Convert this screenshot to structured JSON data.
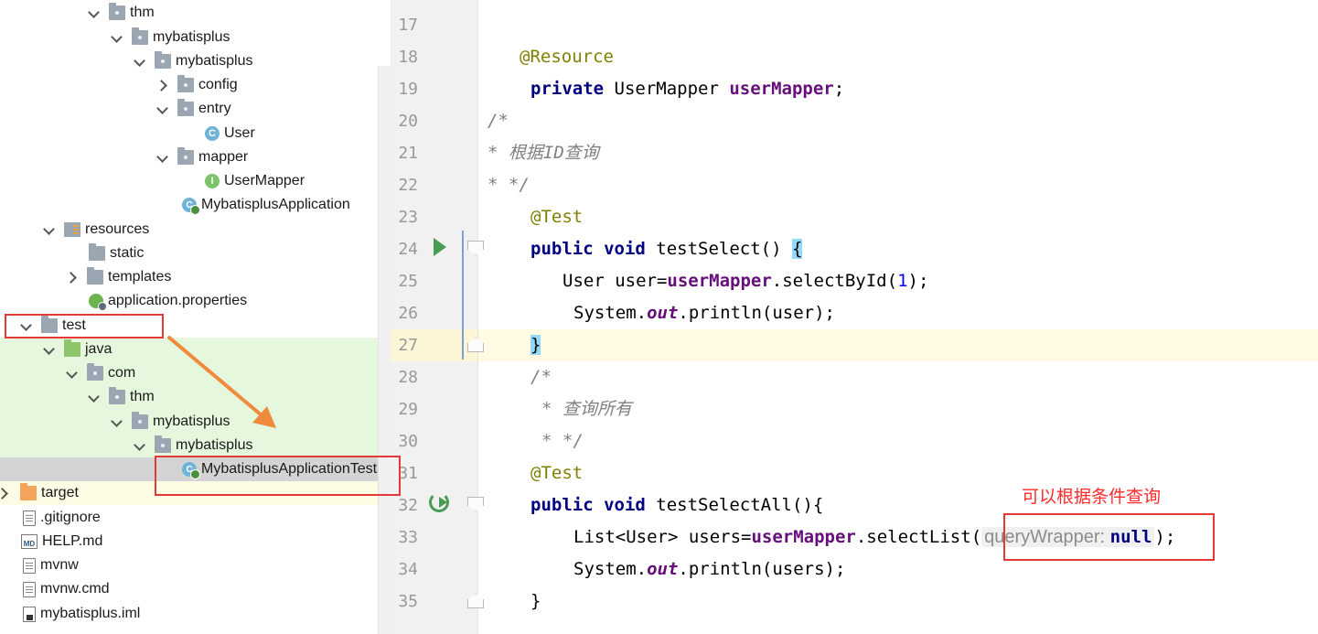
{
  "project_tree": {
    "items": [
      {
        "label": "thm",
        "icon": "package-folder-icon"
      },
      {
        "label": "mybatisplus",
        "icon": "package-folder-icon"
      },
      {
        "label": "mybatisplus",
        "icon": "package-folder-icon"
      },
      {
        "label": "config",
        "icon": "package-folder-icon"
      },
      {
        "label": "entry",
        "icon": "package-folder-icon"
      },
      {
        "label": "User",
        "icon": "class-icon"
      },
      {
        "label": "mapper",
        "icon": "package-folder-icon"
      },
      {
        "label": "UserMapper",
        "icon": "interface-icon"
      },
      {
        "label": "MybatisplusApplication",
        "icon": "spring-boot-class-icon"
      },
      {
        "label": "resources",
        "icon": "resources-folder-icon"
      },
      {
        "label": "static",
        "icon": "folder-icon"
      },
      {
        "label": "templates",
        "icon": "folder-icon"
      },
      {
        "label": "application.properties",
        "icon": "spring-properties-icon"
      },
      {
        "label": "test",
        "icon": "folder-icon"
      },
      {
        "label": "java",
        "icon": "test-source-folder-icon"
      },
      {
        "label": "com",
        "icon": "package-folder-icon"
      },
      {
        "label": "thm",
        "icon": "package-folder-icon"
      },
      {
        "label": "mybatisplus",
        "icon": "package-folder-icon"
      },
      {
        "label": "mybatisplus",
        "icon": "package-folder-icon"
      },
      {
        "label": "MybatisplusApplicationTests",
        "icon": "test-class-icon"
      },
      {
        "label": "target",
        "icon": "excluded-folder-icon"
      },
      {
        "label": ".gitignore",
        "icon": "text-file-icon"
      },
      {
        "label": "HELP.md",
        "icon": "markdown-file-icon"
      },
      {
        "label": "mvnw",
        "icon": "text-file-icon"
      },
      {
        "label": "mvnw.cmd",
        "icon": "text-file-icon"
      },
      {
        "label": "mybatisplus.iml",
        "icon": "module-file-icon"
      }
    ],
    "class_badge": "C",
    "interface_badge": "I",
    "markdown_badge": "MD"
  },
  "editor": {
    "line_numbers": [
      "17",
      "18",
      "19",
      "20",
      "21",
      "22",
      "23",
      "24",
      "25",
      "26",
      "27",
      "28",
      "29",
      "30",
      "31",
      "32",
      "33",
      "34",
      "35"
    ],
    "lines": {
      "l18": {
        "annotation": "@Resource"
      },
      "l19": {
        "kw": "private",
        "type": " UserMapper ",
        "field": "userMapper",
        "end": ";"
      },
      "l20": {
        "comment": "/*"
      },
      "l21": {
        "comment": "* 根据ID查询"
      },
      "l22": {
        "comment": "* */"
      },
      "l23": {
        "annotation": "@Test"
      },
      "l24": {
        "kw1": "public",
        "kw2": " void",
        "rest": " testSelect() ",
        "brace": "{"
      },
      "l25": {
        "pre": "User user=",
        "field": "userMapper",
        "mid": ".selectById(",
        "num": "1",
        "end": ");"
      },
      "l26": {
        "pre": "System.",
        "static": "out",
        "end": ".println(user);"
      },
      "l27": {
        "brace": "}"
      },
      "l28": {
        "comment": "/*"
      },
      "l29": {
        "comment": "* 查询所有"
      },
      "l30": {
        "comment": "* */"
      },
      "l31": {
        "annotation": "@Test"
      },
      "l32": {
        "kw1": "public",
        "kw2": " void",
        "rest": " testSelectAll(){"
      },
      "l33": {
        "pre": "List<User> users=",
        "field": "userMapper",
        "mid": ".selectList(",
        "hint_name": "queryWrapper:",
        "hint_value": "null",
        "end": ");"
      },
      "l34": {
        "pre": "System.",
        "static": "out",
        "end": ".println(users);"
      },
      "l35": {
        "brace": "}"
      }
    }
  },
  "annotation": {
    "note": "可以根据条件查询",
    "colors": {
      "red": "#e53935",
      "arrow": "#f08a3c"
    }
  }
}
